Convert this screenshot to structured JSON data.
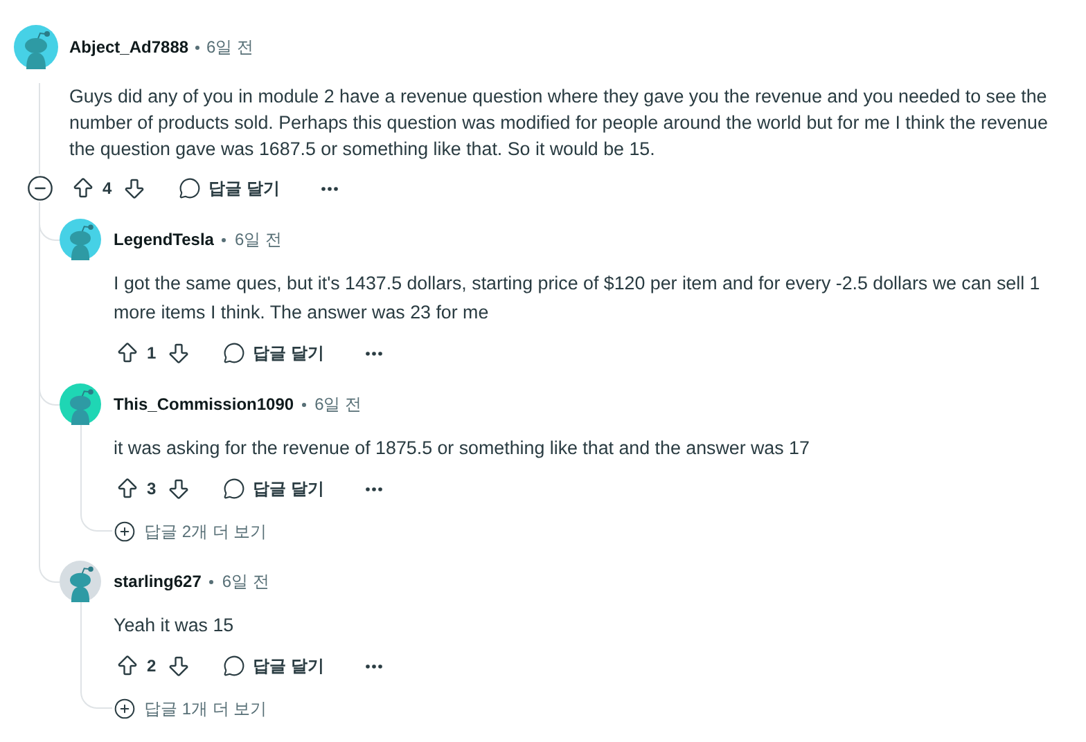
{
  "comments": [
    {
      "author": "Abject_Ad7888",
      "time": "6일 전",
      "color": "#46d1e6",
      "body": "Guys did any of you in module 2 have a revenue question where they gave you the revenue and you needed to see the number of products sold. Perhaps this question was modified for people around the world but for me I think the revenue the question gave was 1687.5 or something like that. So it would be 15.",
      "votes": "4",
      "reply": "답글 달기",
      "expanded": true,
      "children": [
        {
          "author": "LegendTesla",
          "time": "6일 전",
          "color": "#46d1e6",
          "body": "I got the same ques, but it's 1437.5 dollars, starting price of $120 per item and for every -2.5 dollars we can sell 1 more items I think. The answer was 23 for me",
          "votes": "1",
          "reply": "답글 달기"
        },
        {
          "author": "This_Commission1090",
          "time": "6일 전",
          "color": "#1fd6b4",
          "body": "it was asking for the revenue of 1875.5 or something like that and the answer was 17",
          "votes": "3",
          "reply": "답글 달기",
          "more": "답글 2개 더 보기"
        },
        {
          "author": "starling627",
          "time": "6일 전",
          "color": "#d6dde2",
          "body": "Yeah it was 15",
          "votes": "2",
          "reply": "답글 달기",
          "more": "답글 1개 더 보기"
        }
      ]
    }
  ]
}
